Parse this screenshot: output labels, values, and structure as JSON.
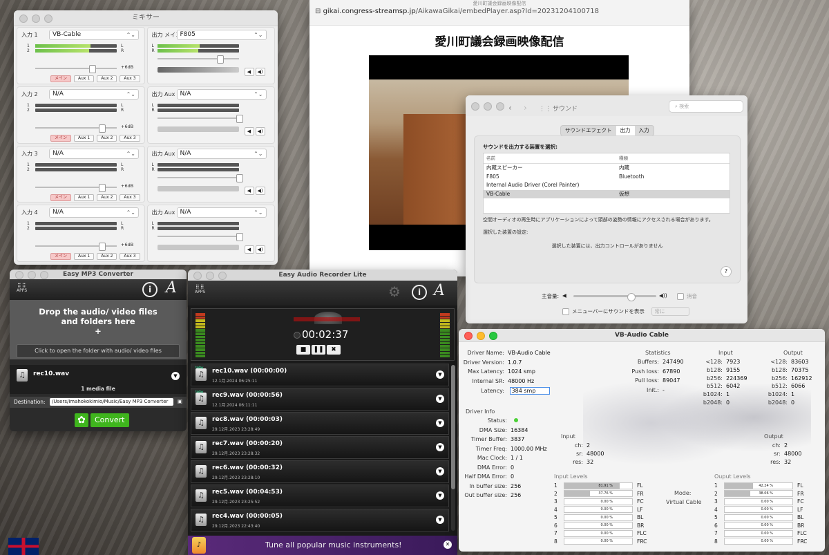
{
  "mixer": {
    "title": "ミキサー",
    "inputs": [
      {
        "label": "入力 1",
        "device": "VB-Cable",
        "db": "+6dB"
      },
      {
        "label": "入力 2",
        "device": "N/A",
        "db": "+6dB"
      },
      {
        "label": "入力 3",
        "device": "N/A",
        "db": "+6dB"
      },
      {
        "label": "入力 4",
        "device": "N/A",
        "db": "+6dB"
      }
    ],
    "outputs": [
      {
        "label": "出力 メイン",
        "device": "F805"
      },
      {
        "label": "出力 Aux 1",
        "device": "N/A"
      },
      {
        "label": "出力 Aux 2",
        "device": "N/A"
      },
      {
        "label": "出力 Aux 3",
        "device": "N/A"
      }
    ],
    "routes": [
      "メイン",
      "Aux 1",
      "Aux 2",
      "Aux 3"
    ],
    "ch_l": "L",
    "ch_r": "R",
    "ch_1": "1",
    "ch_2": "2"
  },
  "browser": {
    "url_domain": "gikai.congress-streamsp.jp",
    "url_path": "/AikawaGikai/embedPlayer.asp?Id=20231204100718",
    "tab_title": "愛川町議会録画映像配信",
    "page_title": "愛川町議会録画映像配信"
  },
  "sound": {
    "title": "サウンド",
    "search_placeholder": "検索",
    "tabs": [
      "サウンドエフェクト",
      "出力",
      "入力"
    ],
    "active_tab": "出力",
    "heading": "サウンドを出力する装置を選択:",
    "col_name": "名前",
    "col_type": "種類",
    "devices": [
      {
        "name": "内蔵スピーカー",
        "type": "内蔵"
      },
      {
        "name": "F805",
        "type": "Bluetooth"
      },
      {
        "name": "Internal Audio Driver (Corel Painter)",
        "type": ""
      },
      {
        "name": "VB-Cable",
        "type": "仮想"
      }
    ],
    "spatial_note": "空間オーディオの再生時にアプリケーションによって頭部の姿勢の情報にアクセスされる場合があります。",
    "selected_settings": "選択した装置の設定:",
    "no_controls": "選択した装置には、出力コントロールがありません",
    "main_volume": "主音量:",
    "mute": "消音",
    "show_in_menubar": "メニューバーにサウンドを表示",
    "menubar_option": "常に",
    "help": "?"
  },
  "mp3": {
    "title": "Easy MP3 Converter",
    "apps": "APPS",
    "drop_line1": "Drop the audio/ video files",
    "drop_line2": "and folders here",
    "drop_plus": "+",
    "open_folder": "Click to open the folder with audio/ video files",
    "file_name": "rec10.wav",
    "count": "1 media file",
    "destination_label": "Destination:",
    "destination_path": "/Users/imahokokimio/Music/Easy MP3 Converter",
    "convert": "Convert"
  },
  "recorder": {
    "title": "Easy Audio Recorder Lite",
    "apps": "APPS",
    "timer": "00:02:37",
    "items": [
      {
        "title": "rec10.wav (00:00:00)",
        "date": "12.1月.2024 06:25:11",
        "today": "today"
      },
      {
        "title": "rec9.wav (00:00:56)",
        "date": "12.1月.2024 06:11:11",
        "today": "today"
      },
      {
        "title": "rec8.wav (00:00:03)",
        "date": "29.12月.2023 23:28:49",
        "today": ""
      },
      {
        "title": "rec7.wav (00:00:20)",
        "date": "29.12月.2023 23:28:32",
        "today": ""
      },
      {
        "title": "rec6.wav (00:00:32)",
        "date": "29.12月.2023 23:28:10",
        "today": ""
      },
      {
        "title": "rec5.wav (00:04:53)",
        "date": "29.12月.2023 23:25:52",
        "today": ""
      },
      {
        "title": "rec4.wav (00:00:05)",
        "date": "29.12月.2023 22:43:40",
        "today": ""
      }
    ],
    "ad_text": "Tune all popular music instruments!"
  },
  "vb": {
    "title": "VB-Audio Cable",
    "driver": [
      {
        "k": "Driver Name:",
        "v": "VB-Audio Cable"
      },
      {
        "k": "Driver Version:",
        "v": "1.0.7"
      },
      {
        "k": "Max Latency:",
        "v": "1024 smp"
      },
      {
        "k": "Internal SR:",
        "v": "48000 Hz"
      }
    ],
    "latency_label": "Latency:",
    "latency_value": "384 smp",
    "stats_title": "Statistics",
    "stats": [
      {
        "k": "Buffers:",
        "v": "247490"
      },
      {
        "k": "Push loss:",
        "v": "67890"
      },
      {
        "k": "Pull loss:",
        "v": "89047"
      },
      {
        "k": "Init.:",
        "v": "-"
      }
    ],
    "input_title": "Input",
    "output_title": "Output",
    "input_stats": [
      {
        "k": "<128:",
        "v": "7923"
      },
      {
        "k": "b128:",
        "v": "9155"
      },
      {
        "k": "b256:",
        "v": "224369"
      },
      {
        "k": "b512:",
        "v": "6042"
      },
      {
        "k": "b1024:",
        "v": "1"
      },
      {
        "k": "b2048:",
        "v": "0"
      }
    ],
    "output_stats": [
      {
        "k": "<128:",
        "v": "83603"
      },
      {
        "k": "b128:",
        "v": "70375"
      },
      {
        "k": "b256:",
        "v": "162912"
      },
      {
        "k": "b512:",
        "v": "6066"
      },
      {
        "k": "b1024:",
        "v": "1"
      },
      {
        "k": "b2048:",
        "v": "0"
      }
    ],
    "driver_info": "Driver Info",
    "info": [
      {
        "k": "Status:",
        "v": ""
      },
      {
        "k": "DMA Size:",
        "v": "16384"
      },
      {
        "k": "Timer Buffer:",
        "v": "3837"
      },
      {
        "k": "Timer Freq:",
        "v": "1000.00 MHz"
      },
      {
        "k": "Mac Clock:",
        "v": "1 / 1"
      },
      {
        "k": "DMA Error:",
        "v": "0"
      },
      {
        "k": "Half DMA Error:",
        "v": "0"
      },
      {
        "k": "In buffer size:",
        "v": "256"
      },
      {
        "k": "Out buffer size:",
        "v": "256"
      }
    ],
    "in_box": {
      "title": "Input",
      "ch": "2",
      "sr": "48000",
      "res": "32"
    },
    "out_box": {
      "title": "Output",
      "ch": "2",
      "sr": "48000",
      "res": "32"
    },
    "ch_k": "ch:",
    "sr_k": "sr:",
    "res_k": "res:",
    "input_levels_title": "Input Levels",
    "output_levels_title": "Ouput Levels",
    "mode_label": "Mode:",
    "mode_value": "Virtual Cable",
    "channels": [
      "FL",
      "FR",
      "FC",
      "LF",
      "BL",
      "BR",
      "FLC",
      "FRC"
    ],
    "input_levels": [
      {
        "n": "1",
        "pct": "81.91 %",
        "frac": 0.8191
      },
      {
        "n": "2",
        "pct": "37.76 %",
        "frac": 0.3776
      },
      {
        "n": "3",
        "pct": "0.00 %",
        "frac": 0
      },
      {
        "n": "4",
        "pct": "0.00 %",
        "frac": 0
      },
      {
        "n": "5",
        "pct": "0.00 %",
        "frac": 0
      },
      {
        "n": "6",
        "pct": "0.00 %",
        "frac": 0
      },
      {
        "n": "7",
        "pct": "0.00 %",
        "frac": 0
      },
      {
        "n": "8",
        "pct": "0.00 %",
        "frac": 0
      }
    ],
    "output_levels": [
      {
        "n": "1",
        "pct": "42.24 %",
        "frac": 0.4224
      },
      {
        "n": "2",
        "pct": "38.06 %",
        "frac": 0.3806
      },
      {
        "n": "3",
        "pct": "0.00 %",
        "frac": 0
      },
      {
        "n": "4",
        "pct": "0.00 %",
        "frac": 0
      },
      {
        "n": "5",
        "pct": "0.00 %",
        "frac": 0
      },
      {
        "n": "6",
        "pct": "0.00 %",
        "frac": 0
      },
      {
        "n": "7",
        "pct": "0.00 %",
        "frac": 0
      },
      {
        "n": "8",
        "pct": "0.00 %",
        "frac": 0
      }
    ]
  },
  "colors": {
    "accent_green": "#3fb51d",
    "meter_green": "#6cc04a"
  },
  "icons": [
    "search-icon",
    "speaker-icon",
    "gear-icon",
    "info-icon",
    "music-note-icon",
    "chevron-down-icon",
    "flag-uk-icon"
  ]
}
